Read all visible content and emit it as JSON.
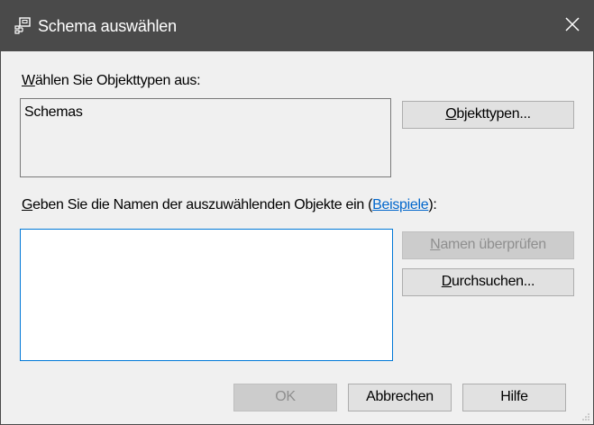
{
  "window": {
    "title": "Schema auswählen",
    "icon": "schema-picker-icon",
    "close_icon": "close-icon"
  },
  "object_types": {
    "label_prefix": "W",
    "label_rest": "ählen Sie Objekttypen aus:",
    "value": "Schemas",
    "button_prefix": "O",
    "button_rest": "bjekttypen..."
  },
  "names": {
    "label_prefix": "G",
    "label_middle": "eben Sie die Namen der auszuwählenden Objekte ein (",
    "label_link": "Beispiele",
    "label_suffix": "):",
    "input_value": "",
    "check_button_prefix": "N",
    "check_button_rest": "amen überprüfen",
    "browse_button_prefix": "D",
    "browse_button_rest": "urchsuchen..."
  },
  "footer": {
    "ok": "OK",
    "cancel": "Abbrechen",
    "help": "Hilfe"
  },
  "colors": {
    "titlebar": "#4a4a4a",
    "dialog_background": "#f0f0f0",
    "focus_border": "#0078d7",
    "link": "#0066cc"
  }
}
